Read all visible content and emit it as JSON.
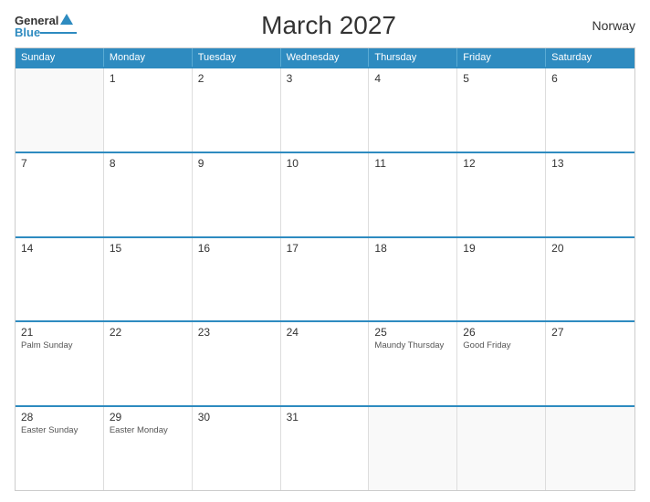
{
  "header": {
    "title": "March 2027",
    "country": "Norway",
    "logo": {
      "general": "General",
      "blue": "Blue"
    }
  },
  "calendar": {
    "days_of_week": [
      "Sunday",
      "Monday",
      "Tuesday",
      "Wednesday",
      "Thursday",
      "Friday",
      "Saturday"
    ],
    "weeks": [
      [
        {
          "day": "",
          "holiday": ""
        },
        {
          "day": "1",
          "holiday": ""
        },
        {
          "day": "2",
          "holiday": ""
        },
        {
          "day": "3",
          "holiday": ""
        },
        {
          "day": "4",
          "holiday": ""
        },
        {
          "day": "5",
          "holiday": ""
        },
        {
          "day": "6",
          "holiday": ""
        }
      ],
      [
        {
          "day": "7",
          "holiday": ""
        },
        {
          "day": "8",
          "holiday": ""
        },
        {
          "day": "9",
          "holiday": ""
        },
        {
          "day": "10",
          "holiday": ""
        },
        {
          "day": "11",
          "holiday": ""
        },
        {
          "day": "12",
          "holiday": ""
        },
        {
          "day": "13",
          "holiday": ""
        }
      ],
      [
        {
          "day": "14",
          "holiday": ""
        },
        {
          "day": "15",
          "holiday": ""
        },
        {
          "day": "16",
          "holiday": ""
        },
        {
          "day": "17",
          "holiday": ""
        },
        {
          "day": "18",
          "holiday": ""
        },
        {
          "day": "19",
          "holiday": ""
        },
        {
          "day": "20",
          "holiday": ""
        }
      ],
      [
        {
          "day": "21",
          "holiday": "Palm Sunday"
        },
        {
          "day": "22",
          "holiday": ""
        },
        {
          "day": "23",
          "holiday": ""
        },
        {
          "day": "24",
          "holiday": ""
        },
        {
          "day": "25",
          "holiday": "Maundy Thursday"
        },
        {
          "day": "26",
          "holiday": "Good Friday"
        },
        {
          "day": "27",
          "holiday": ""
        }
      ],
      [
        {
          "day": "28",
          "holiday": "Easter Sunday"
        },
        {
          "day": "29",
          "holiday": "Easter Monday"
        },
        {
          "day": "30",
          "holiday": ""
        },
        {
          "day": "31",
          "holiday": ""
        },
        {
          "day": "",
          "holiday": ""
        },
        {
          "day": "",
          "holiday": ""
        },
        {
          "day": "",
          "holiday": ""
        }
      ]
    ]
  }
}
